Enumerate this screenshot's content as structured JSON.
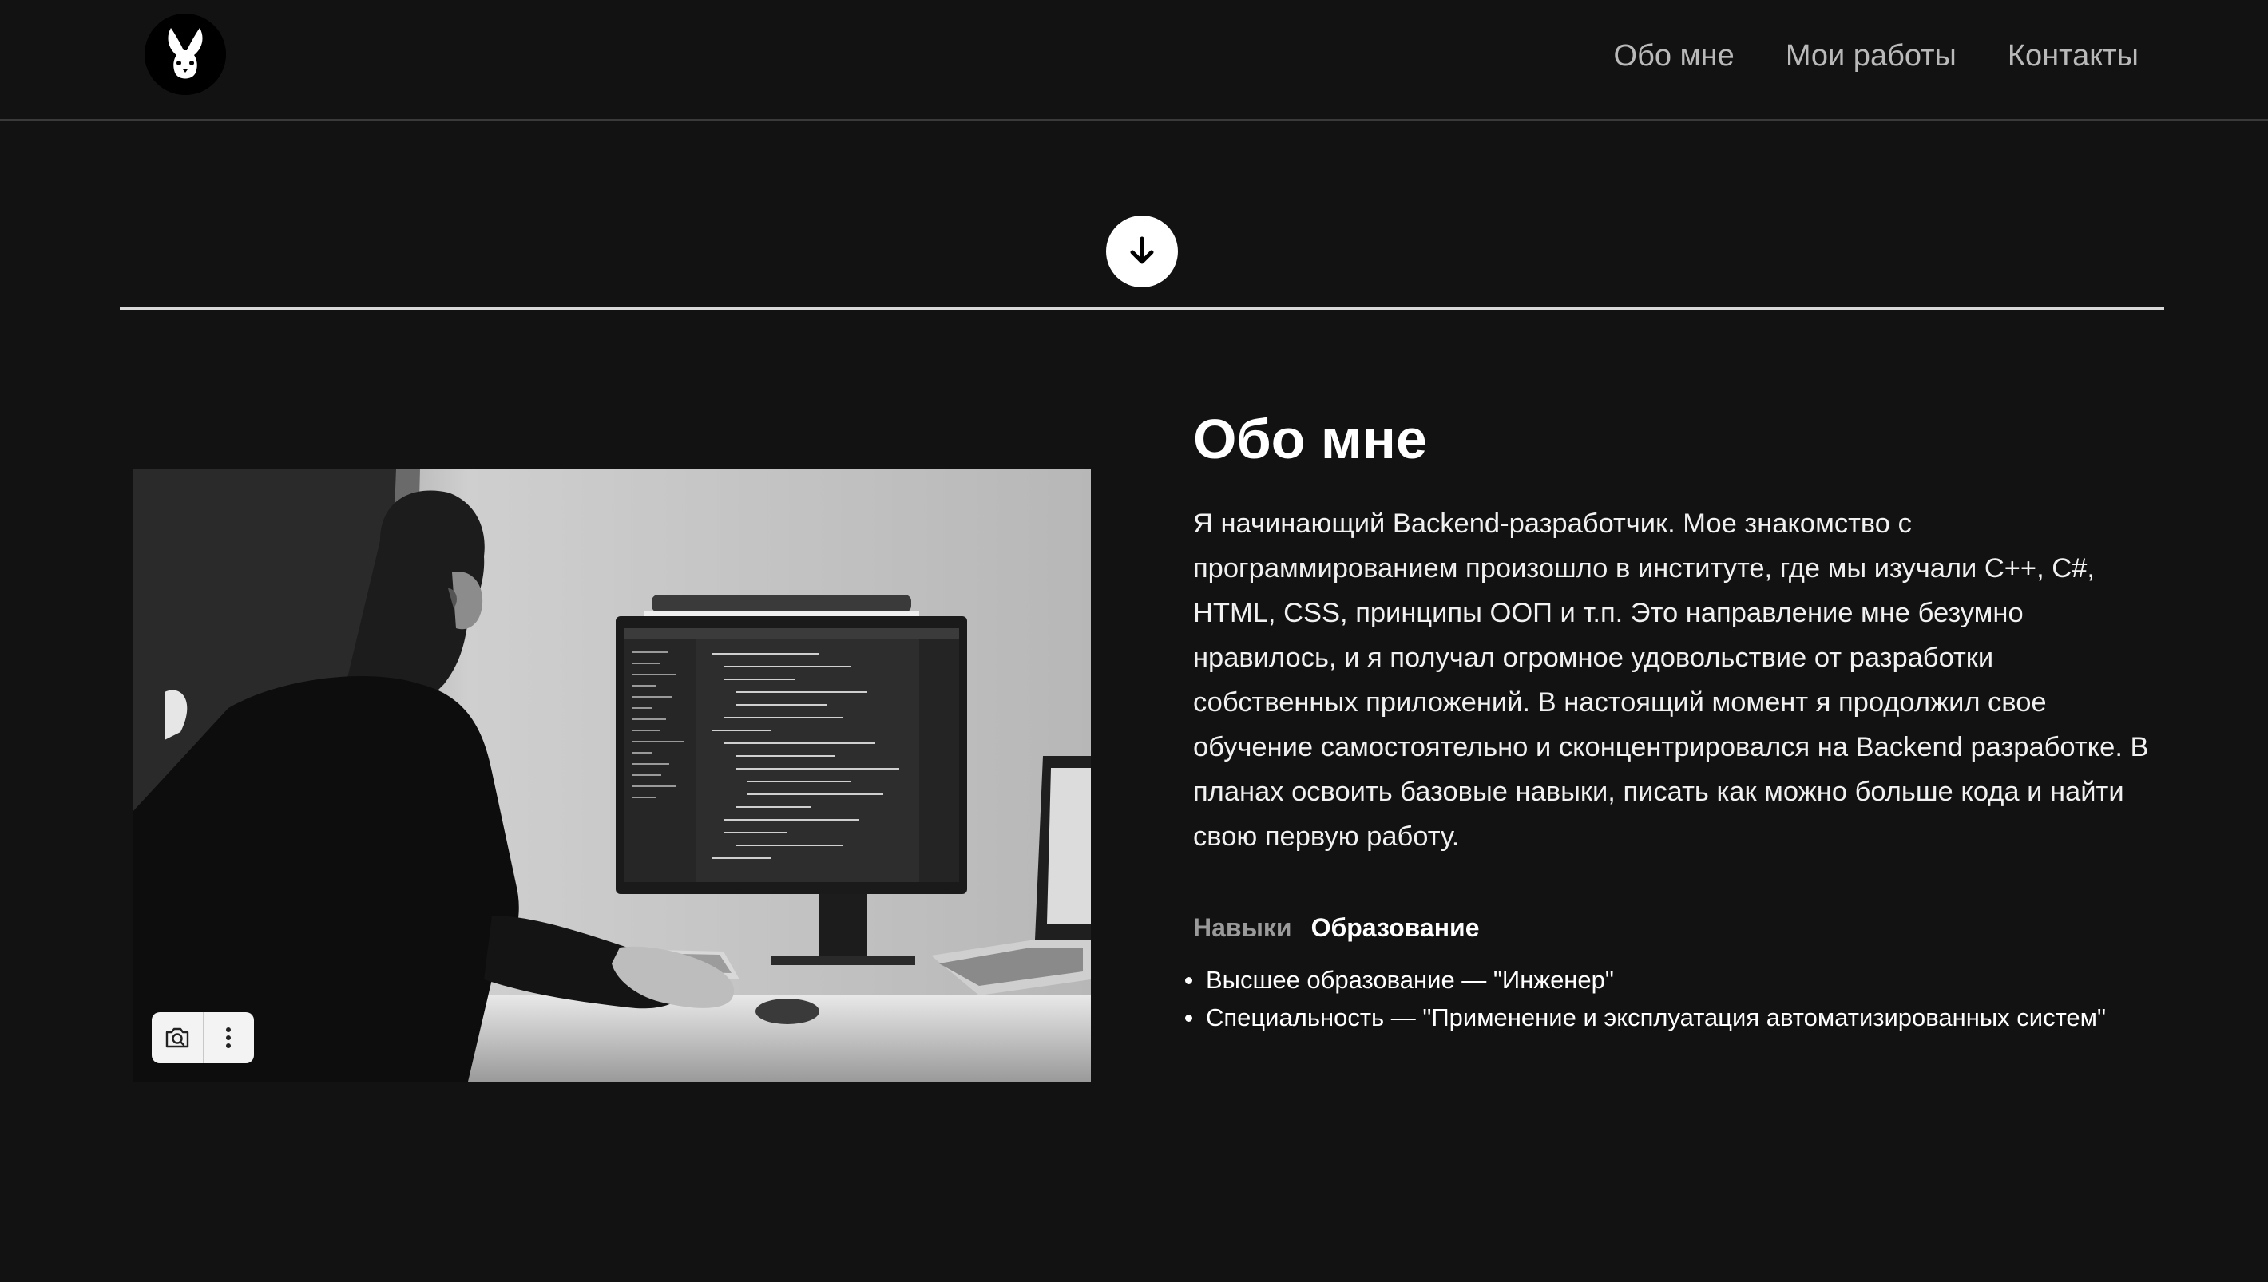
{
  "header": {
    "logo_icon": "rabbit-logo-icon",
    "nav": [
      {
        "label": "Обо мне"
      },
      {
        "label": "Мои работы"
      },
      {
        "label": "Контакты"
      }
    ]
  },
  "scroll_icon": "arrow-down-icon",
  "about": {
    "title": "Обо мне",
    "text": "Я начинающий Backend-разработчик. Мое знакомство с программированием произошло в институте, где мы изучали C++, C#, HTML, CSS, принципы ООП и т.п. Это направление мне безумно нравилось, и я получал огромное удовольствие от разработки собственных приложений. В настоящий момент я продолжил свое обучение самостоятельно и сконцентрировался на Backend разработке. В планах освоить базовые навыки, писать как можно больше кода и найти свою первую работу.",
    "tabs": [
      {
        "label": "Навыки",
        "active": false
      },
      {
        "label": "Образование",
        "active": true
      }
    ],
    "education": [
      "Высшее образование — \"Инженер\"",
      "Специальность — \"Применение и эксплуатация автоматизированных систем\""
    ]
  },
  "photo": {
    "tools": [
      "camera-search-icon",
      "more-vertical-icon"
    ]
  },
  "colors": {
    "background": "#121212",
    "nav_text": "#b9b9b9",
    "tab_inactive": "#9a9a9a"
  }
}
